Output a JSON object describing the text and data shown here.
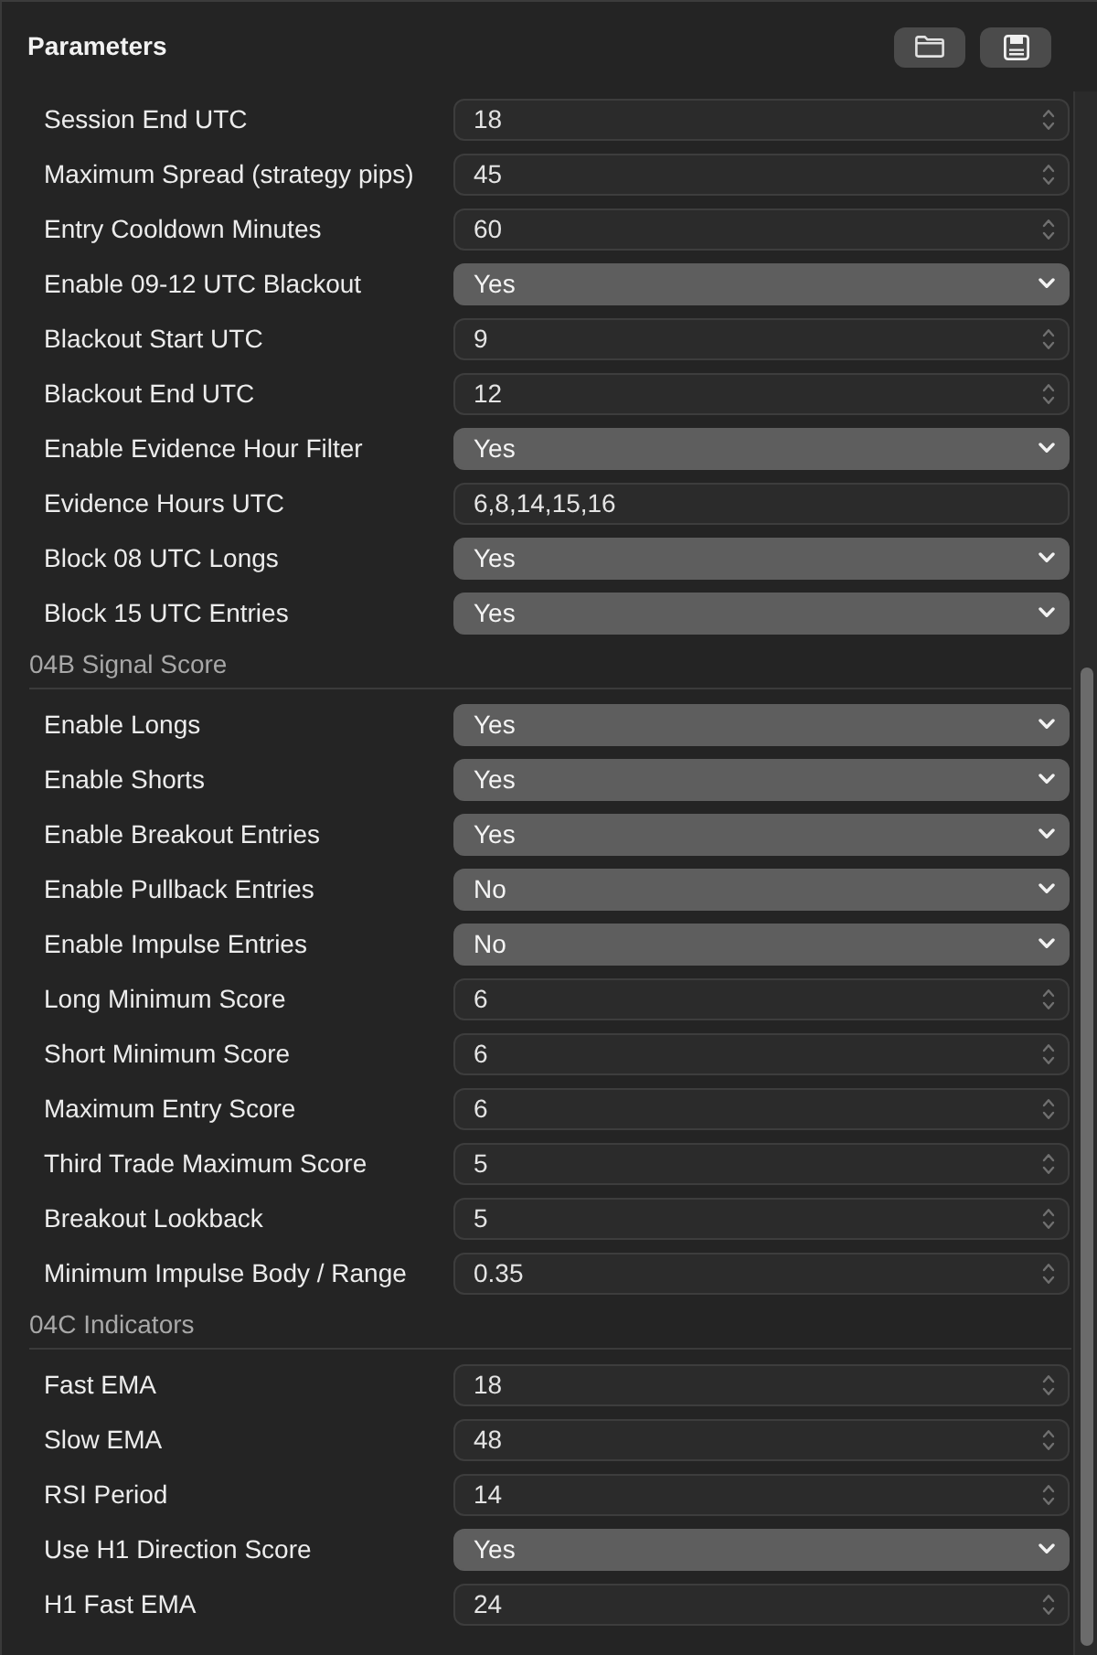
{
  "panel": {
    "title": "Parameters"
  },
  "sections": [
    {
      "rows": [
        {
          "label": "Session End UTC",
          "kind": "number",
          "value": "18"
        },
        {
          "label": "Maximum Spread (strategy pips)",
          "kind": "number",
          "value": "45"
        },
        {
          "label": "Entry Cooldown Minutes",
          "kind": "number",
          "value": "60"
        },
        {
          "label": "Enable 09-12 UTC Blackout",
          "kind": "select",
          "value": "Yes"
        },
        {
          "label": "Blackout Start UTC",
          "kind": "number",
          "value": "9"
        },
        {
          "label": "Blackout End UTC",
          "kind": "number",
          "value": "12"
        },
        {
          "label": "Enable Evidence Hour Filter",
          "kind": "select",
          "value": "Yes"
        },
        {
          "label": "Evidence Hours UTC",
          "kind": "text",
          "value": "6,8,14,15,16"
        },
        {
          "label": "Block 08 UTC Longs",
          "kind": "select",
          "value": "Yes"
        },
        {
          "label": "Block 15 UTC Entries",
          "kind": "select",
          "value": "Yes"
        }
      ]
    },
    {
      "heading": "04B Signal Score",
      "rows": [
        {
          "label": "Enable Longs",
          "kind": "select",
          "value": "Yes"
        },
        {
          "label": "Enable Shorts",
          "kind": "select",
          "value": "Yes"
        },
        {
          "label": "Enable Breakout Entries",
          "kind": "select",
          "value": "Yes"
        },
        {
          "label": "Enable Pullback Entries",
          "kind": "select",
          "value": "No"
        },
        {
          "label": "Enable Impulse Entries",
          "kind": "select",
          "value": "No"
        },
        {
          "label": "Long Minimum Score",
          "kind": "number",
          "value": "6"
        },
        {
          "label": "Short Minimum Score",
          "kind": "number",
          "value": "6"
        },
        {
          "label": "Maximum Entry Score",
          "kind": "number",
          "value": "6"
        },
        {
          "label": "Third Trade Maximum Score",
          "kind": "number",
          "value": "5"
        },
        {
          "label": "Breakout Lookback",
          "kind": "number",
          "value": "5"
        },
        {
          "label": "Minimum Impulse Body / Range",
          "kind": "number",
          "value": "0.35"
        }
      ]
    },
    {
      "heading": "04C Indicators",
      "rows": [
        {
          "label": "Fast EMA",
          "kind": "number",
          "value": "18"
        },
        {
          "label": "Slow EMA",
          "kind": "number",
          "value": "48"
        },
        {
          "label": "RSI Period",
          "kind": "number",
          "value": "14"
        },
        {
          "label": "Use H1 Direction Score",
          "kind": "select",
          "value": "Yes"
        },
        {
          "label": "H1 Fast EMA",
          "kind": "number",
          "value": "24"
        }
      ]
    }
  ]
}
